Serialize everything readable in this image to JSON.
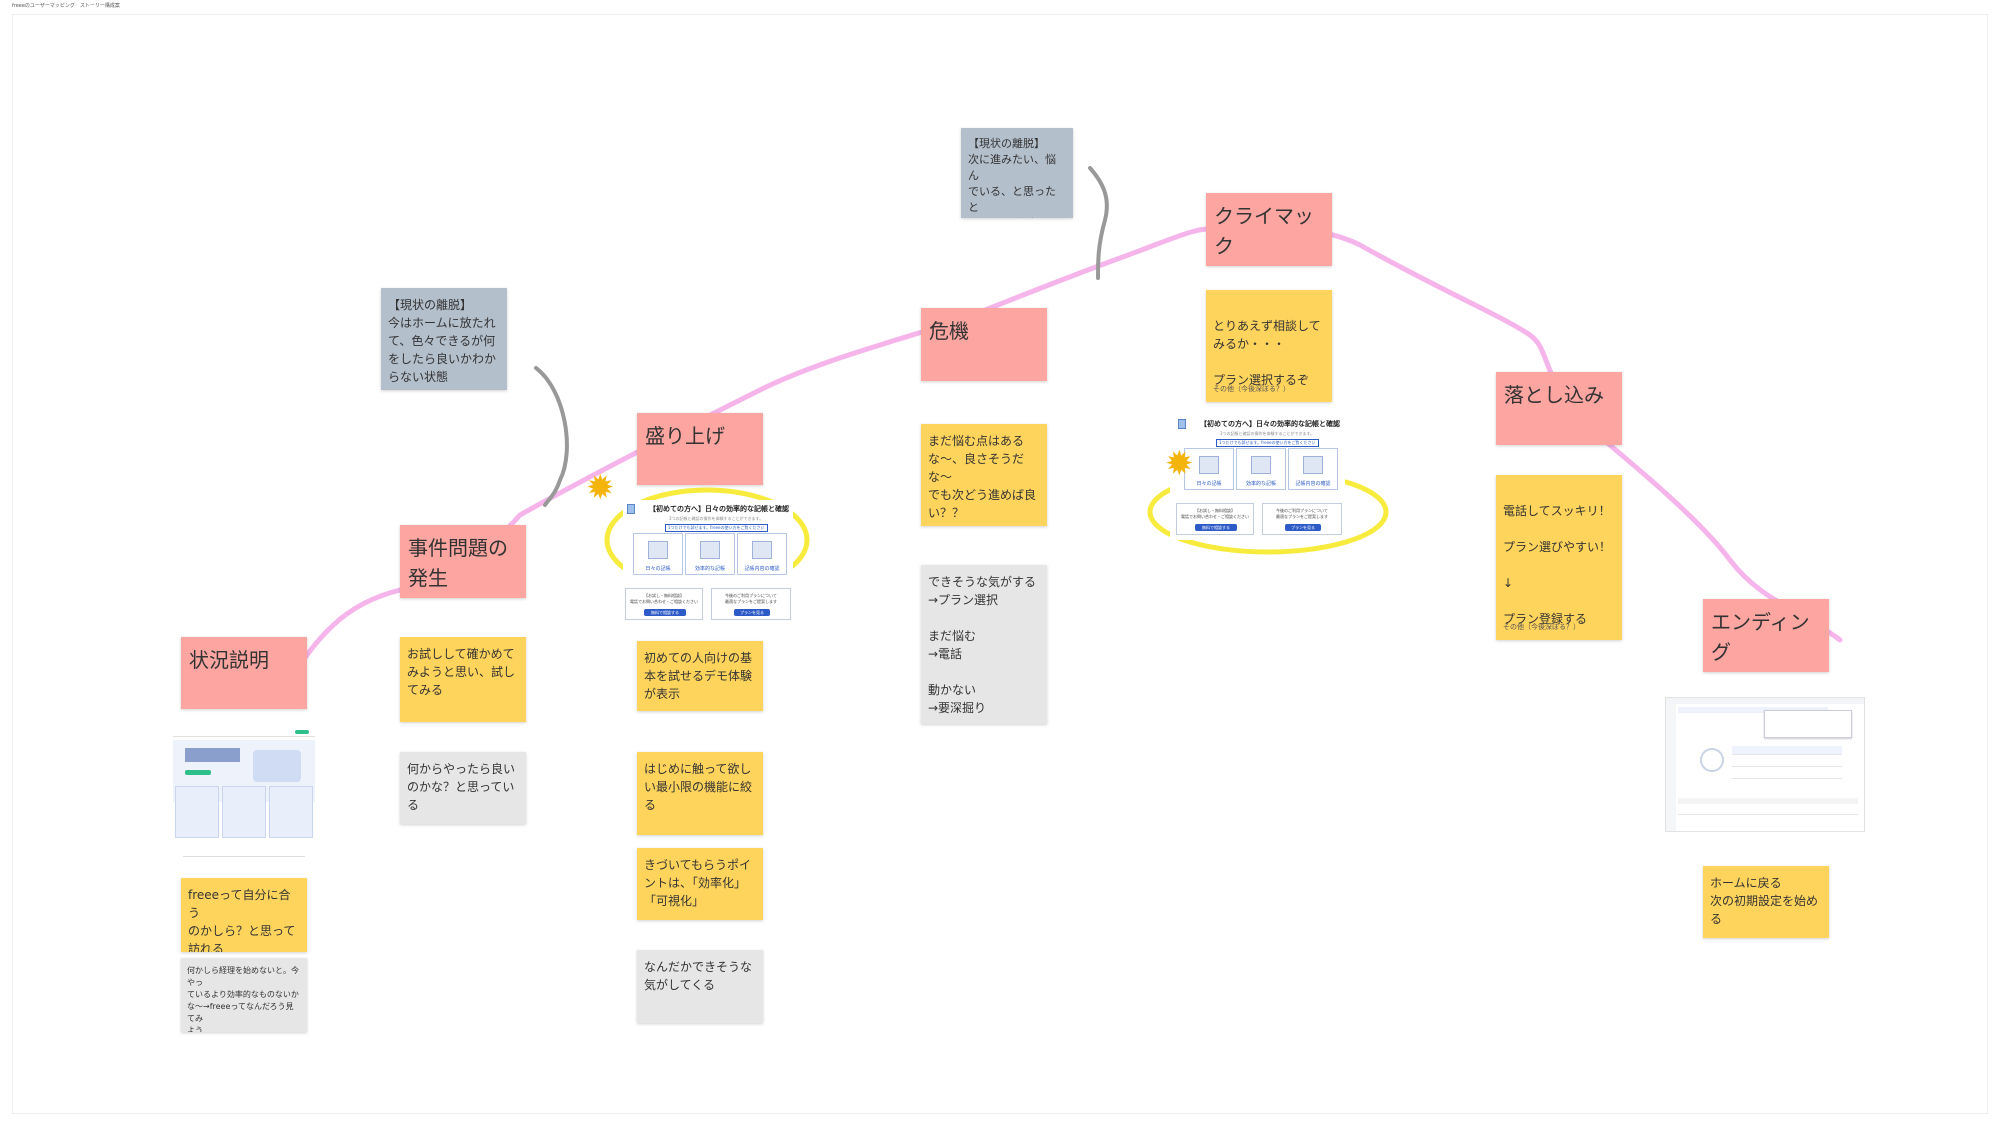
{
  "board": {
    "frame_title": "freeeのユーザーマッピング　ストーリー構成案"
  },
  "stages": [
    {
      "label": "状況説明"
    },
    {
      "label": "事件問題の\n発生"
    },
    {
      "label": "盛り上げ"
    },
    {
      "label": "危機"
    },
    {
      "label": "クライマック\nス"
    },
    {
      "label": "落とし込み"
    },
    {
      "label": "エンディング"
    }
  ],
  "sticky_notes": {
    "s1_yellow": "freeeって自分に合う\nのかしら？と思って\n訪れる",
    "s1_gray": "何かしら経理を始めないと。今やっ\nているより効率的なものないか\nな〜→freeeってなんだろう見てみ\nよう",
    "s2_yellow": "お試しして確かめて\nみようと思い、試し\nてみる",
    "s2_gray": "何からやったら良い\nのかな？と思ってい\nる",
    "s3_yellow1": "初めての人向けの基\n本を試せるデモ体験\nが表示",
    "s3_yellow2": "はじめに触って欲し\nい最小限の機能に絞\nる",
    "s3_yellow3": "きづいてもらうポイ\nントは、「効率化」\n「可視化」",
    "s3_gray": "なんだかできそうな\n気がしてくる",
    "s4_yellow": "まだ悩む点はある\nな〜、良さそうだ\nな〜\nでも次どう進めば良\nい？？",
    "s4_gray": "できそうな気がする\n→プラン選択\n\nまだ悩む\n→電話\n\n動かない\n→要深掘り",
    "s5_yellow_main": "とりあえず相談して\nみるか・・・\n\nプラン選択するぞ",
    "s5_yellow_small": "その他（今後深ぼる？）",
    "s6_yellow_main": "電話してスッキリ！\n\nプラン選びやすい！\n\n↓\n\nプラン登録する",
    "s6_yellow_small": "その他（今後深ぼる？）",
    "s7_yellow": "ホームに戻る\n次の初期設定を始め\nる",
    "slate1": "【現状の離脱】\n今はホームに放たれ\nて、色々できるが何\nをしたら良いかわか\nらない状態",
    "slate2": "【現状の離脱】\n次に進みたい、悩ん\nでいる、と思ったと\nきに進む道がわから\nない"
  },
  "mockups": {
    "onboarding_title": "【初めての方へ】日々の効率的な記帳と確認",
    "onboarding_sub": "3つの記帳と確認の操作を体験することができます。",
    "onboarding_link": "1つだけでも試せます。freeeの使い方をご覧ください",
    "card_labels": [
      "日々の記帳",
      "効率的な記帳",
      "記帳内容の確認"
    ],
    "box1_text": "【お試し・無料相談】\n電話でお問い合わせ・ご相談ください",
    "box2_text": "今後のご利用プランについて\n最適なプランをご提案します",
    "btn1": "無料で相談する",
    "btn2": "プランを見る"
  },
  "colors": {
    "curve": "#f5b5ea",
    "highlight": "#f7ec3d",
    "connector": "#999999",
    "pink_note": "#fca5a1",
    "yellow_note": "#ffd45c",
    "gray_note": "#e6e6e6",
    "slate_note": "#b4bfcc"
  }
}
